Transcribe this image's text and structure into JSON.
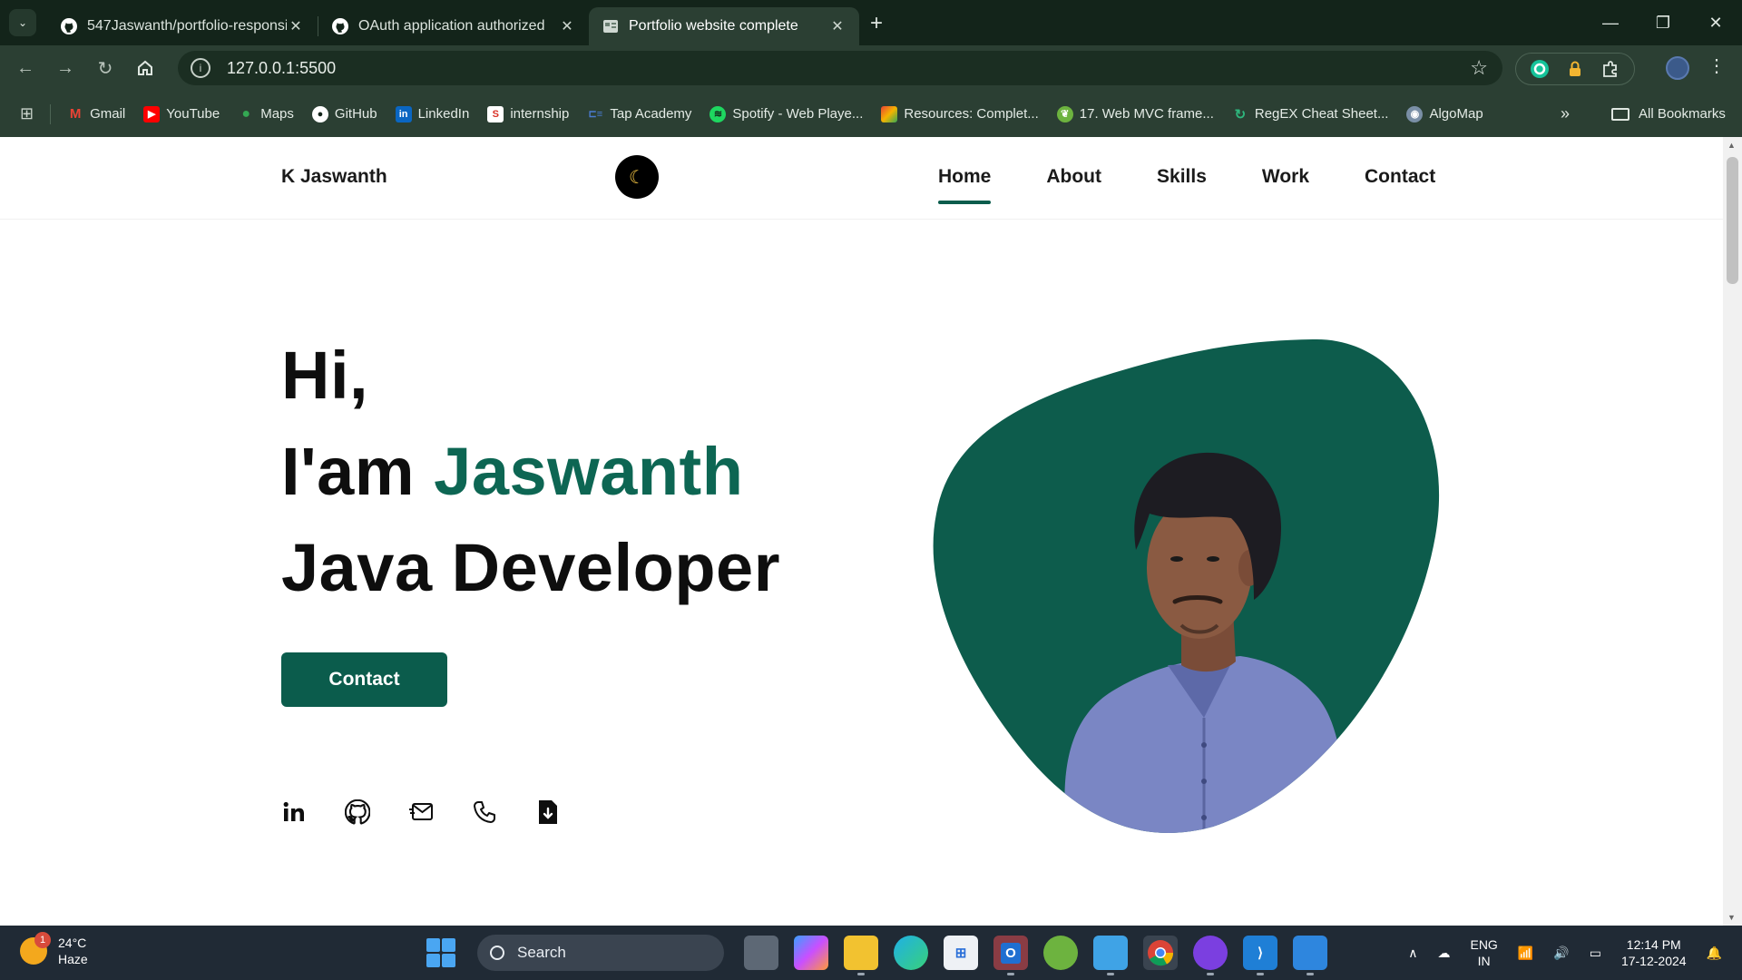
{
  "browser": {
    "tabs": [
      {
        "title": "547Jaswanth/portfolio-responsi",
        "icon": "github-icon"
      },
      {
        "title": "OAuth application authorized",
        "icon": "github-icon"
      },
      {
        "title": "Portfolio website complete",
        "icon": "page-icon",
        "active": true
      }
    ],
    "url": "127.0.0.1:5500",
    "bookmarks": [
      {
        "label": "Gmail",
        "color": "#ea4335"
      },
      {
        "label": "YouTube",
        "color": "#ff0000"
      },
      {
        "label": "Maps",
        "color": "#34a853"
      },
      {
        "label": "GitHub",
        "color": "#ffffff"
      },
      {
        "label": "LinkedIn",
        "color": "#0a66c2"
      },
      {
        "label": "internship",
        "color": "#d93025"
      },
      {
        "label": "Tap Academy",
        "color": "#4a7bd0"
      },
      {
        "label": "Spotify - Web Playe...",
        "color": "#1ed760"
      },
      {
        "label": "Resources: Complet...",
        "color": "#f4b400"
      },
      {
        "label": "17. Web MVC frame...",
        "color": "#6db33f"
      },
      {
        "label": "RegEX Cheat Sheet...",
        "color": "#2eb67d"
      },
      {
        "label": "AlgoMap",
        "color": "#7a8fa6"
      }
    ],
    "all_bookmarks": "All Bookmarks"
  },
  "site": {
    "logo": "K Jaswanth",
    "theme_icon": "moon-icon",
    "nav": [
      {
        "label": "Home",
        "active": true
      },
      {
        "label": "About"
      },
      {
        "label": "Skills"
      },
      {
        "label": "Work"
      },
      {
        "label": "Contact"
      }
    ],
    "hero": {
      "greeting": "Hi,",
      "intro": "I'am ",
      "name": "Jaswanth",
      "role": "Java Developer",
      "cta": "Contact"
    },
    "socials": [
      "linkedin-icon",
      "github-icon",
      "mail-icon",
      "phone-icon",
      "download-resume-icon"
    ],
    "accent": "#0b5c4c"
  },
  "taskbar": {
    "weather": {
      "temp": "24°C",
      "condition": "Haze",
      "badge": "1"
    },
    "search": "Search",
    "tray": {
      "lang": "ENG",
      "region": "IN",
      "time": "12:14 PM",
      "date": "17-12-2024"
    }
  }
}
